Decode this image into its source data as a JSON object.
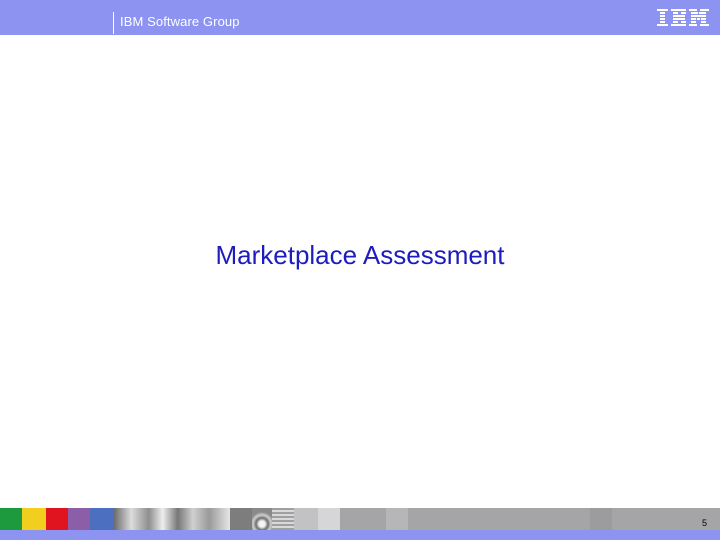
{
  "header": {
    "title": "IBM Software Group",
    "logo_text": "IBM"
  },
  "slide": {
    "title": "Marketplace Assessment"
  },
  "footer": {
    "page_number": "5"
  },
  "colors": {
    "header_band": "#8c93f0",
    "title_text": "#1d1dbd",
    "footer_band": "#a5a5a8"
  }
}
